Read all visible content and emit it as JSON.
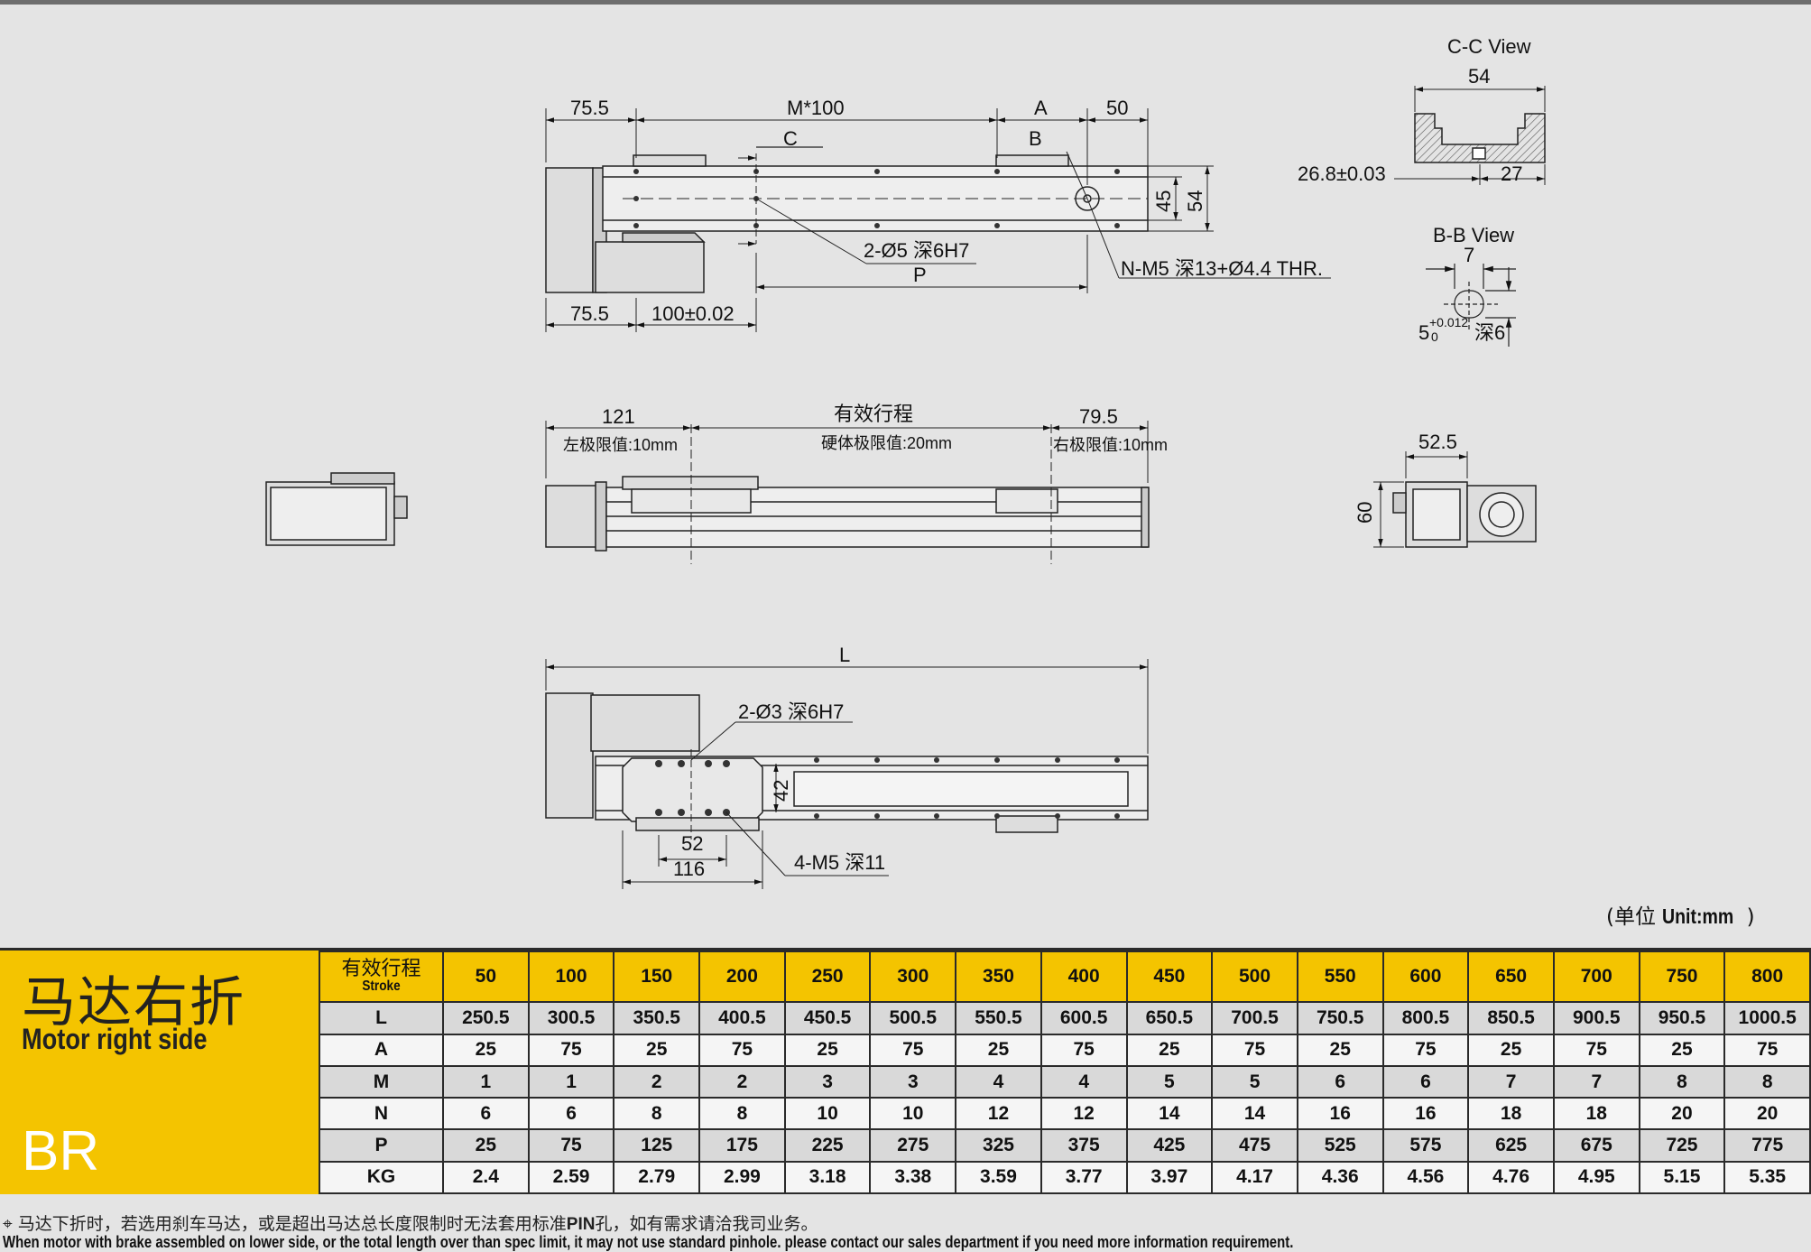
{
  "top_view": {
    "dims": [
      "75.5",
      "M*100",
      "A",
      "50",
      "C",
      "B",
      "45",
      "54",
      "2-Ø5 深6H7",
      "P",
      "N-M5 深13+Ø4.4 THR.",
      "75.5",
      "100±0.02"
    ]
  },
  "cc_view": {
    "title": "C-C View",
    "dims": [
      "54",
      "26.8±0.03",
      "27"
    ]
  },
  "bb_view": {
    "title": "B-B View",
    "dims": [
      "7",
      "5",
      "+0.012",
      "0",
      "深6"
    ]
  },
  "side_view": {
    "dims": [
      "121",
      "有效行程",
      "79.5",
      "左极限值:10mm",
      "硬体极限值:20mm",
      "右极限值:10mm"
    ]
  },
  "end_view": {
    "dims": [
      "52.5",
      "60"
    ]
  },
  "bottom_view": {
    "dims": [
      "L",
      "2-Ø3 深6H7",
      "42",
      "52",
      "116",
      "4-M5 深11"
    ]
  },
  "unit": {
    "cn": "(单位 ",
    "en": "Unit:mm",
    ")": ")",
    "close": ")"
  },
  "label_box": {
    "cn": "马达右折",
    "en": "Motor right side",
    "code": "BR"
  },
  "table": {
    "stroke_cn": "有效行程",
    "stroke_en": "Stroke",
    "strokes": [
      "50",
      "100",
      "150",
      "200",
      "250",
      "300",
      "350",
      "400",
      "450",
      "500",
      "550",
      "600",
      "650",
      "700",
      "750",
      "800"
    ],
    "rows": [
      {
        "label": "L",
        "values": [
          "250.5",
          "300.5",
          "350.5",
          "400.5",
          "450.5",
          "500.5",
          "550.5",
          "600.5",
          "650.5",
          "700.5",
          "750.5",
          "800.5",
          "850.5",
          "900.5",
          "950.5",
          "1000.5"
        ]
      },
      {
        "label": "A",
        "values": [
          "25",
          "75",
          "25",
          "75",
          "25",
          "75",
          "25",
          "75",
          "25",
          "75",
          "25",
          "75",
          "25",
          "75",
          "25",
          "75"
        ]
      },
      {
        "label": "M",
        "values": [
          "1",
          "1",
          "2",
          "2",
          "3",
          "3",
          "4",
          "4",
          "5",
          "5",
          "6",
          "6",
          "7",
          "7",
          "8",
          "8"
        ]
      },
      {
        "label": "N",
        "values": [
          "6",
          "6",
          "8",
          "8",
          "10",
          "10",
          "12",
          "12",
          "14",
          "14",
          "16",
          "16",
          "18",
          "18",
          "20",
          "20"
        ]
      },
      {
        "label": "P",
        "values": [
          "25",
          "75",
          "125",
          "175",
          "225",
          "275",
          "325",
          "375",
          "425",
          "475",
          "525",
          "575",
          "625",
          "675",
          "725",
          "775"
        ]
      },
      {
        "label": "KG",
        "values": [
          "2.4",
          "2.59",
          "2.79",
          "2.99",
          "3.18",
          "3.38",
          "3.59",
          "3.77",
          "3.97",
          "4.17",
          "4.36",
          "4.56",
          "4.76",
          "4.95",
          "5.15",
          "5.35"
        ]
      }
    ]
  },
  "notes": {
    "cn_a": "马达下折时，若选用刹车马达，或是超出马达总长度限制时无法套用标准",
    "cn_pin": "PIN",
    "cn_b": "孔，如有需求请洽我司业务。",
    "en": "When motor with brake assembled on lower side, or the total length over than spec limit, it may not use standard pinhole. please contact our sales department if you need more information requirement."
  }
}
